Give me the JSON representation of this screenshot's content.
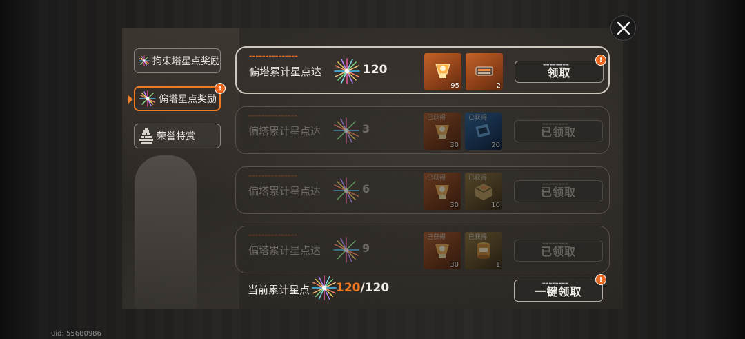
{
  "uid": "uid: 55680986",
  "tabs": [
    {
      "label": "拘束塔星点奖励",
      "icon": "starburst-icon",
      "active": false
    },
    {
      "label": "偏塔星点奖励",
      "icon": "starburst-icon",
      "active": true
    },
    {
      "label": "荣誉特赏",
      "icon": "trophy-stack-icon",
      "active": false
    }
  ],
  "rows": [
    {
      "label": "偏塔累计星点达",
      "target": "120",
      "status": "claimable",
      "button": "领取",
      "alert": "!",
      "items": [
        {
          "name": "orange-core-item",
          "qty": "95",
          "got": "",
          "rarity": "orange"
        },
        {
          "name": "machine-part-item",
          "qty": "2",
          "got": "",
          "rarity": "orange"
        }
      ]
    },
    {
      "label": "偏塔累计星点达",
      "target": "3",
      "status": "claimed",
      "button": "已领取",
      "items": [
        {
          "name": "orange-core-item",
          "qty": "30",
          "got": "已获得",
          "rarity": "orange"
        },
        {
          "name": "blue-device-item",
          "qty": "20",
          "got": "已获得",
          "rarity": "blue"
        }
      ]
    },
    {
      "label": "偏塔累计星点达",
      "target": "6",
      "status": "claimed",
      "button": "已领取",
      "items": [
        {
          "name": "orange-core-item",
          "qty": "30",
          "got": "已获得",
          "rarity": "orange"
        },
        {
          "name": "gold-box-item",
          "qty": "10",
          "got": "已获得",
          "rarity": "gold"
        }
      ]
    },
    {
      "label": "偏塔累计星点达",
      "target": "9",
      "status": "claimed",
      "button": "已领取",
      "items": [
        {
          "name": "orange-core-item",
          "qty": "30",
          "got": "已获得",
          "rarity": "orange"
        },
        {
          "name": "gold-canister-item",
          "qty": "1",
          "got": "已获得",
          "rarity": "gold"
        }
      ]
    }
  ],
  "footer": {
    "label": "当前累计星点",
    "current": "120",
    "separator": "/",
    "max": "120",
    "button": "一键领取",
    "alert": "!"
  },
  "colors": {
    "accent": "#f07a22",
    "alert": "#e8661e"
  }
}
